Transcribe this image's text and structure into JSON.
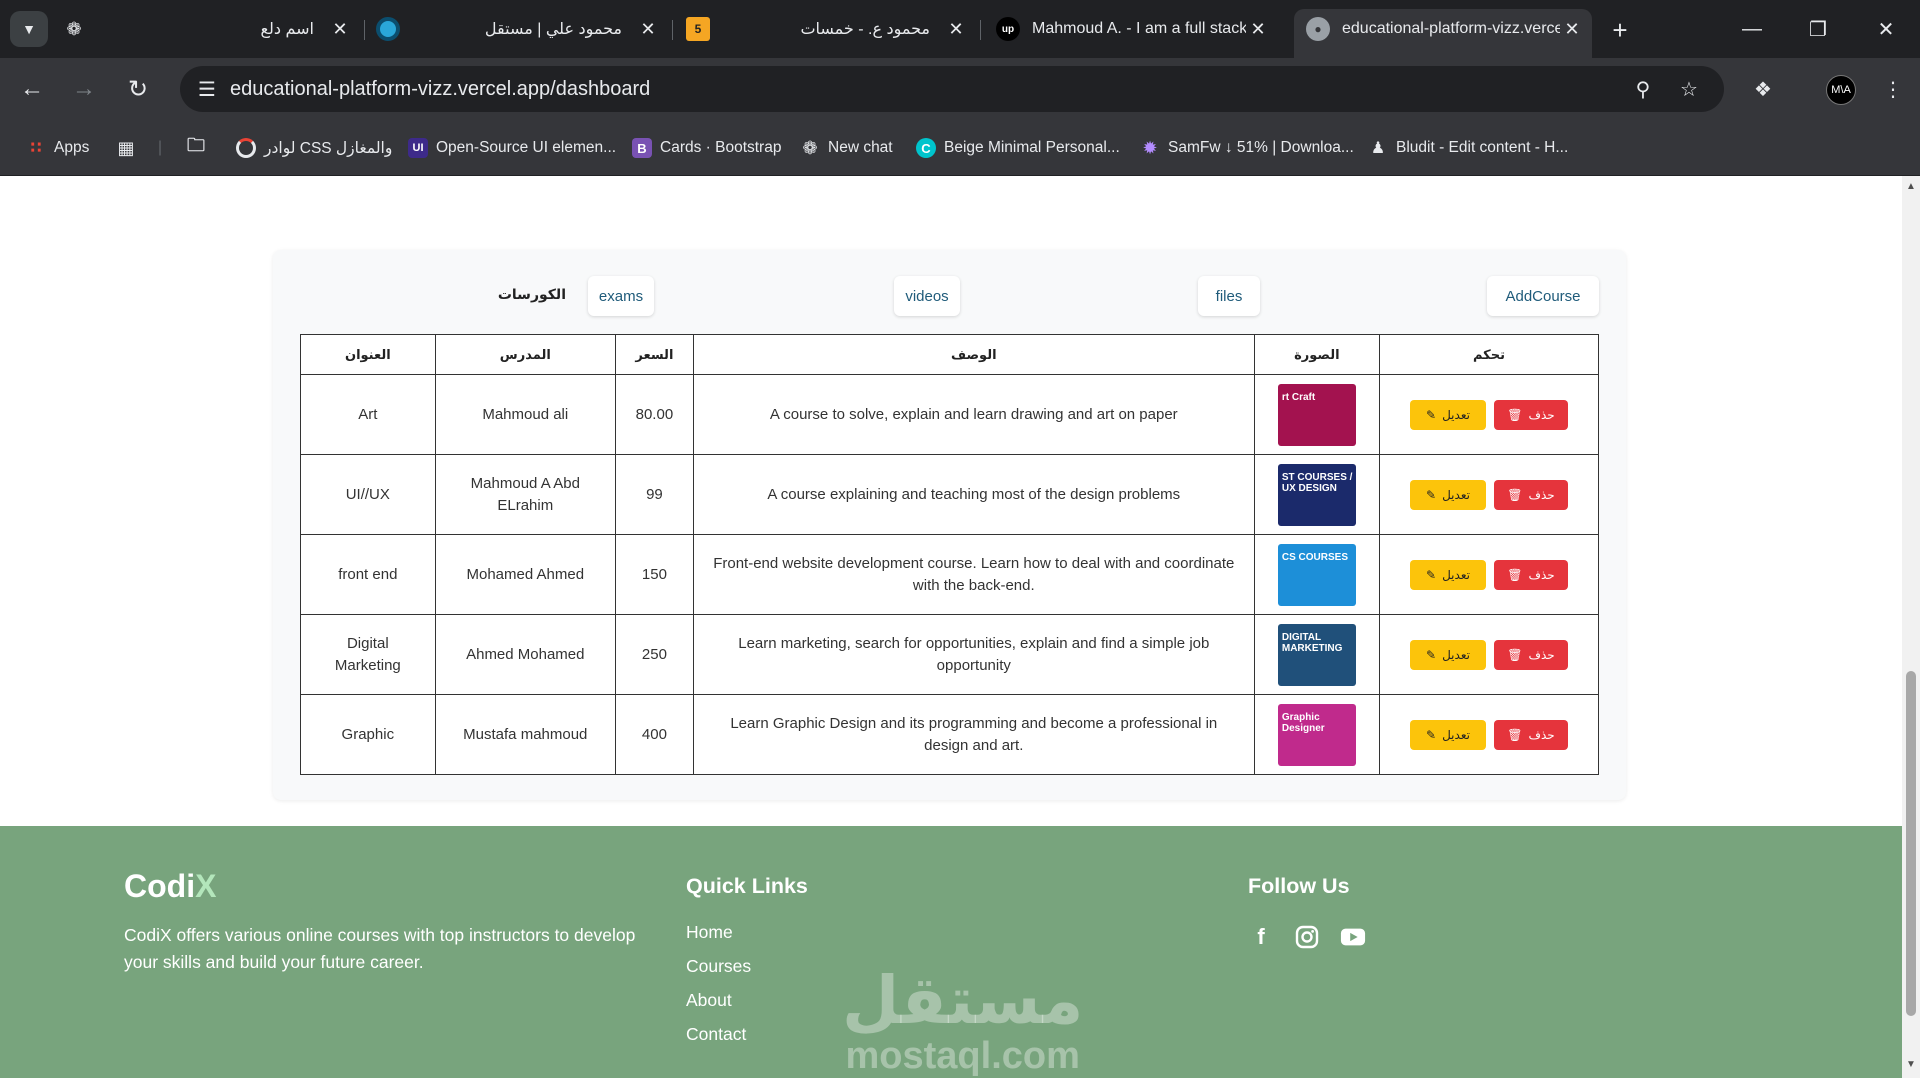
{
  "browser": {
    "tabs": [
      {
        "title": "اسم دلع",
        "favicon": "chatgpt-icon"
      },
      {
        "title": "محمود علي | مستقل",
        "favicon": "mostaql-icon"
      },
      {
        "title": "محمود ع. - خمسات",
        "favicon": "khamsat-icon"
      },
      {
        "title": "Mahmoud A. - I am a full stack",
        "favicon": "upwork-icon"
      },
      {
        "title": "educational-platform-vizz.verce",
        "favicon": "globe-icon",
        "active": true
      }
    ],
    "url": "educational-platform-vizz.vercel.app/dashboard",
    "profile_initials": "M\\A",
    "bookmarks": [
      {
        "label": "Apps",
        "icon": "apps-grid-icon"
      },
      {
        "label": "لوادر CSS والمغازل",
        "icon": "loader-ring-icon"
      },
      {
        "label": "Open-Source UI elemen...",
        "icon": "uiverse-icon"
      },
      {
        "label": "Cards · Bootstrap",
        "icon": "bootstrap-icon"
      },
      {
        "label": "New chat",
        "icon": "chatgpt-icon"
      },
      {
        "label": "Beige Minimal Personal...",
        "icon": "canva-icon"
      },
      {
        "label": "SamFw ↓ 51% | Downloa...",
        "icon": "samfw-icon"
      },
      {
        "label": "Bludit - Edit content - H...",
        "icon": "bludit-icon"
      }
    ]
  },
  "dashboard": {
    "title": "الكورسات",
    "nav": {
      "exams": "exams",
      "videos": "videos",
      "files": "files",
      "add_course": "AddCourse"
    },
    "table": {
      "headers": {
        "title": "العنوان",
        "instructor": "المدرس",
        "price": "السعر",
        "description": "الوصف",
        "image": "الصورة",
        "control": "تحكم"
      },
      "edit_label": "تعديل",
      "delete_label": "حذف",
      "rows": [
        {
          "title": "Art",
          "instructor": "Mahmoud ali",
          "price": "80.00",
          "description": "A course to solve, explain and learn drawing and art on paper",
          "image_text": "rt Craft",
          "image_color": "#a3124f"
        },
        {
          "title": "UI//UX",
          "instructor": "Mahmoud A Abd ELrahim",
          "price": "99",
          "description": "A course explaining and teaching most of the design problems",
          "image_text": "ST COURSES / UX DESIGN",
          "image_color": "#1b2a6b"
        },
        {
          "title": "front end",
          "instructor": "Mohamed Ahmed",
          "price": "150",
          "description": "Front-end website development course. Learn how to deal with and coordinate with the back-end.",
          "image_text": "CS COURSES",
          "image_color": "#1d8fd8"
        },
        {
          "title": "Digital Marketing",
          "instructor": "Ahmed Mohamed",
          "price": "250",
          "description": "Learn marketing, search for opportunities, explain and find a simple job opportunity",
          "image_text": "DIGITAL MARKETING",
          "image_color": "#20507a"
        },
        {
          "title": "Graphic",
          "instructor": "Mustafa mahmoud",
          "price": "400",
          "description": "Learn Graphic Design and its programming and become a professional in design and art.",
          "image_text": "Graphic Designer",
          "image_color": "#c02a8c"
        }
      ]
    }
  },
  "footer": {
    "brand_main": "Codi",
    "brand_accent": "X",
    "description": "CodiX offers various online courses with top instructors to develop your skills and build your future career.",
    "quick_links_title": "Quick Links",
    "links": [
      "Home",
      "Courses",
      "About",
      "Contact"
    ],
    "follow_title": "Follow Us",
    "social": [
      "facebook-icon",
      "instagram-icon",
      "youtube-icon"
    ],
    "watermark_ar": "مستقل",
    "watermark_en": "mostaql.com"
  },
  "colors": {
    "footer_bg": "#78a47d",
    "edit_button": "#fcc40b",
    "delete_button": "#e5343c",
    "nav_button_text": "#1f5b7a"
  }
}
